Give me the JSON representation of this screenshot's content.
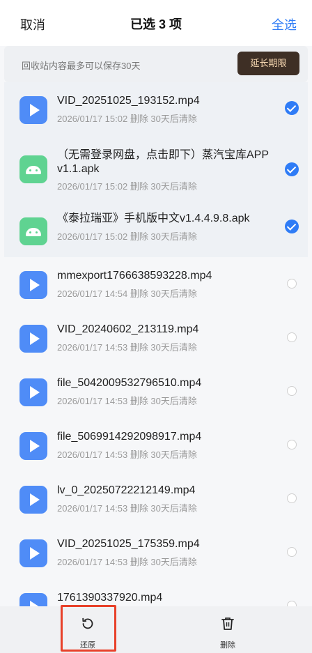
{
  "header": {
    "cancel_label": "取消",
    "title": "已选 3 项",
    "select_all_label": "全选"
  },
  "notice": {
    "text": "回收站内容最多可以保存30天",
    "extend_label": "延长期限"
  },
  "files": [
    {
      "name": "VID_20251025_193152.mp4",
      "meta": "2026/01/17 15:02 删除 30天后清除",
      "type": "video",
      "selected": true
    },
    {
      "name": "（无需登录网盘，点击即下）蒸汽宝库APPv1.1.apk",
      "meta": "2026/01/17 15:02 删除 30天后清除",
      "type": "apk",
      "selected": true
    },
    {
      "name": "《泰拉瑞亚》手机版中文v1.4.4.9.8.apk",
      "meta": "2026/01/17 15:02 删除 30天后清除",
      "type": "apk",
      "selected": true
    },
    {
      "name": "mmexport1766638593228.mp4",
      "meta": "2026/01/17 14:54 删除 30天后清除",
      "type": "video",
      "selected": false
    },
    {
      "name": "VID_20240602_213119.mp4",
      "meta": "2026/01/17 14:53 删除 30天后清除",
      "type": "video",
      "selected": false
    },
    {
      "name": "file_5042009532796510.mp4",
      "meta": "2026/01/17 14:53 删除 30天后清除",
      "type": "video",
      "selected": false
    },
    {
      "name": "file_5069914292098917.mp4",
      "meta": "2026/01/17 14:53 删除 30天后清除",
      "type": "video",
      "selected": false
    },
    {
      "name": "lv_0_20250722212149.mp4",
      "meta": "2026/01/17 14:53 删除 30天后清除",
      "type": "video",
      "selected": false
    },
    {
      "name": "VID_20251025_175359.mp4",
      "meta": "2026/01/17 14:53 删除 30天后清除",
      "type": "video",
      "selected": false
    },
    {
      "name": "1761390337920.mp4",
      "meta": "",
      "type": "video",
      "selected": false
    }
  ],
  "toolbar": {
    "restore_label": "还原",
    "delete_label": "删除"
  },
  "colors": {
    "accent": "#2f7cf6",
    "highlight": "#e8412a",
    "video_icon": "#4f8cf7",
    "apk_icon": "#5fd391"
  }
}
